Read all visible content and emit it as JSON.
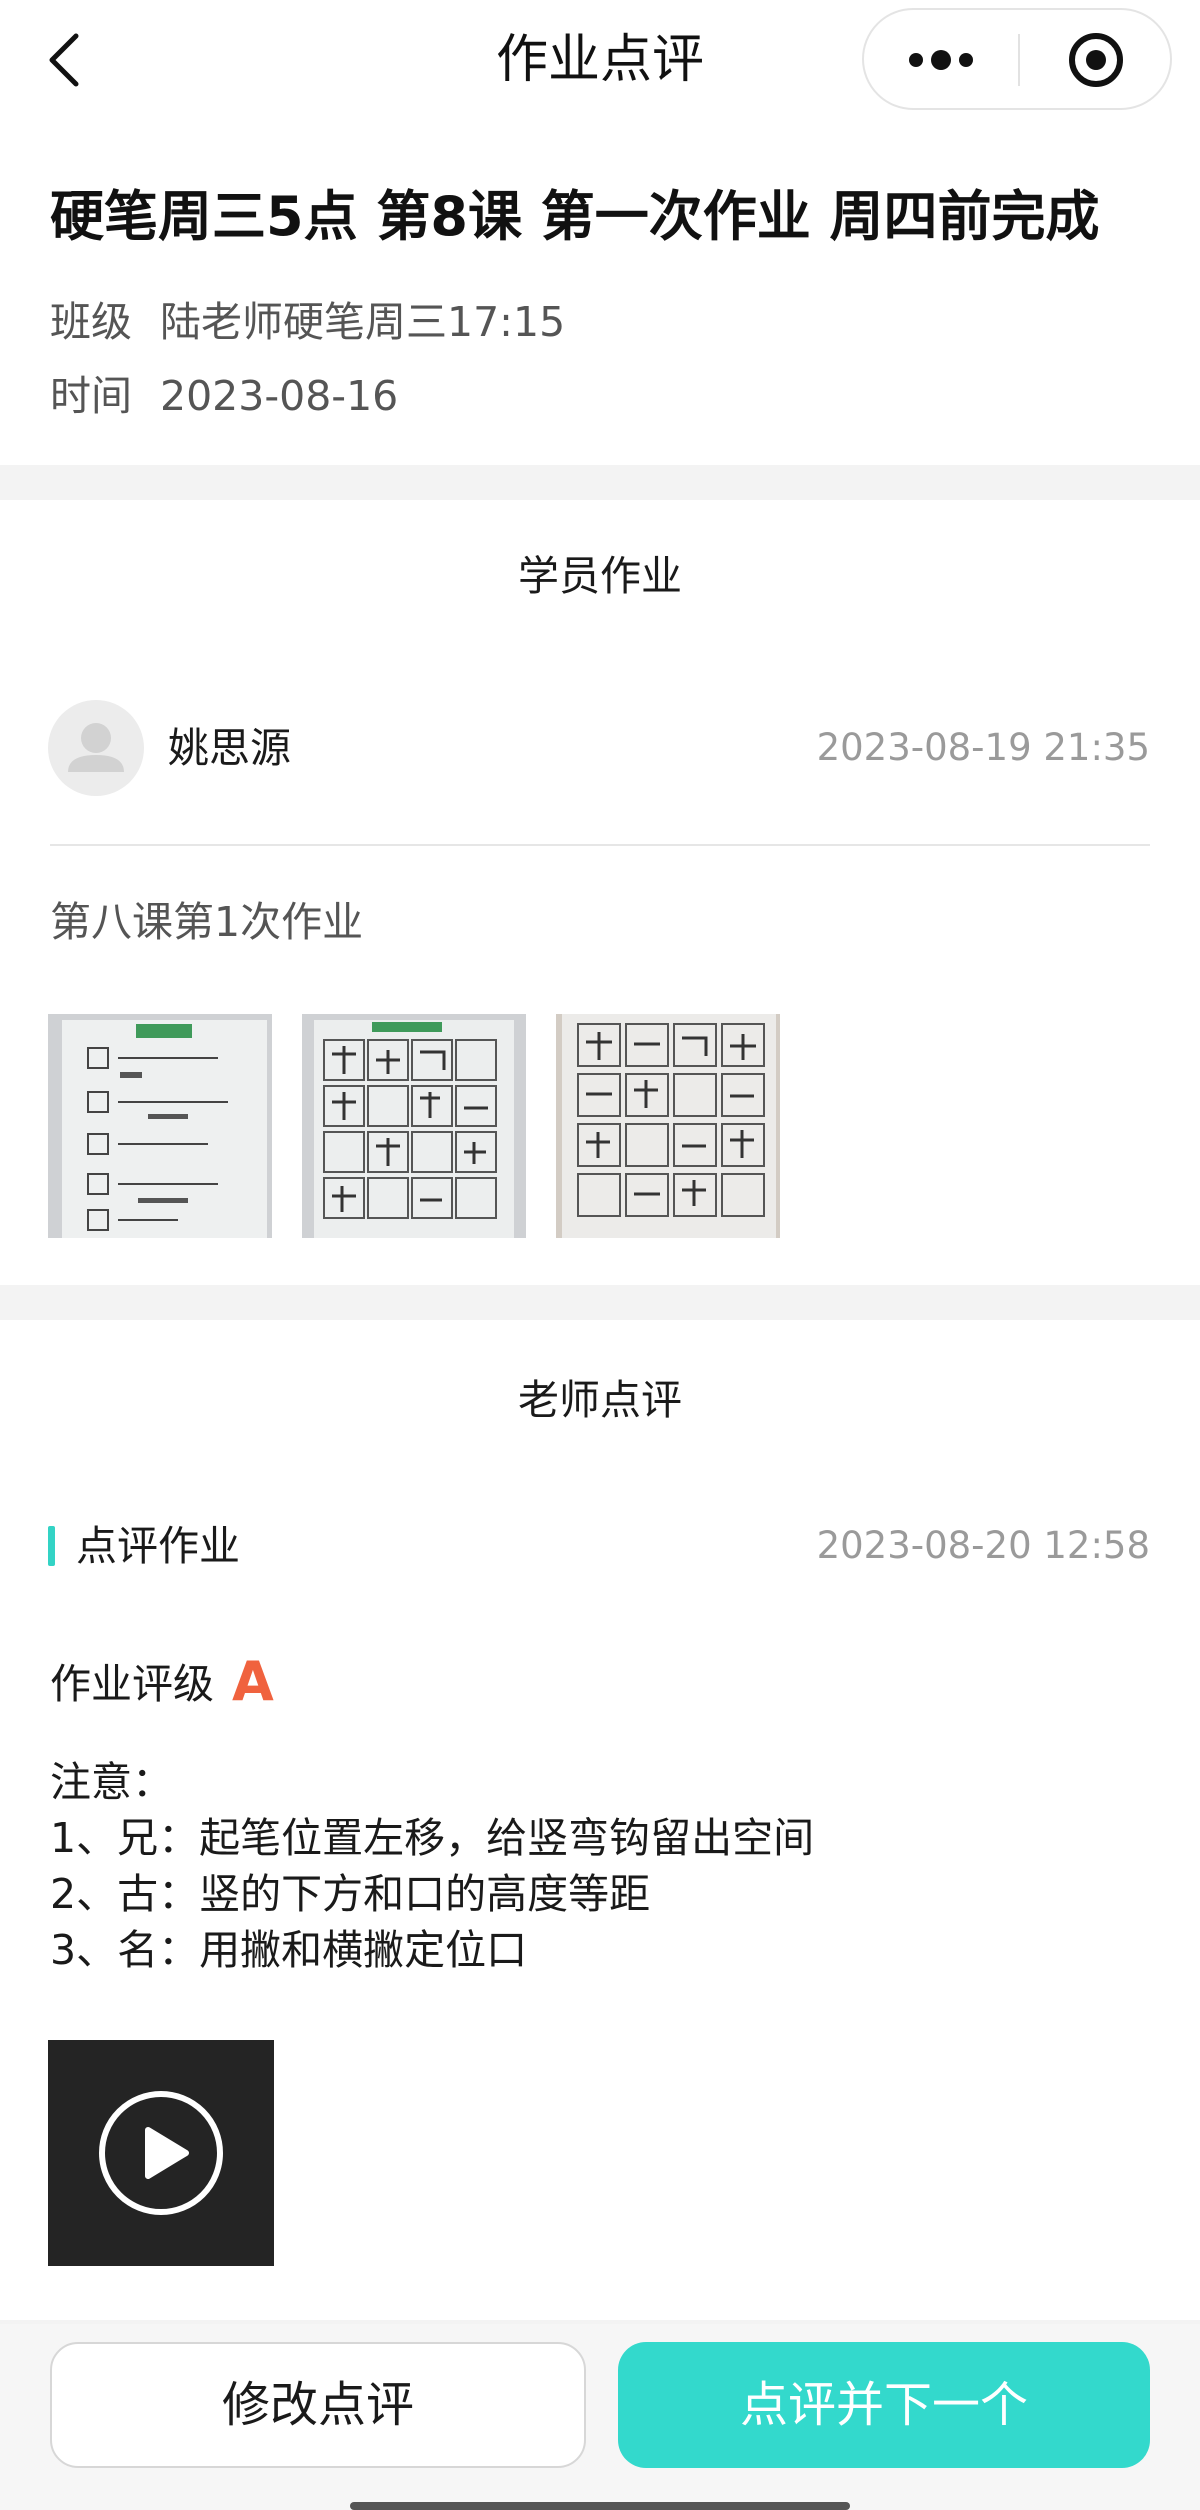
{
  "nav": {
    "title": "作业点评",
    "back_icon": "chevron-left-icon",
    "more_icon": "more-dots-icon",
    "close_icon": "target-circle-icon"
  },
  "homework": {
    "title": "硬笔周三5点 第8课 第一次作业 周四前完成",
    "class_label": "班级",
    "class_value": "陆老师硬笔周三17:15",
    "time_label": "时间",
    "time_value": "2023-08-16"
  },
  "student_section": {
    "title": "学员作业",
    "student_name": "姚思源",
    "submit_time": "2023-08-19 21:35",
    "text": "第八课第1次作业",
    "images": [
      "homework-photo-1",
      "homework-photo-2",
      "homework-photo-3"
    ]
  },
  "teacher_section": {
    "title": "老师点评",
    "review_label": "点评作业",
    "review_time": "2023-08-20 12:58",
    "grade_label": "作业评级",
    "grade_value": "A",
    "comment_lines": [
      "注意：",
      "1、兄：起笔位置左移，给竖弯钩留出空间",
      "2、古：竖的下方和口的高度等距",
      "3、名：用撇和横撇定位口"
    ],
    "video_icon": "play-icon"
  },
  "actions": {
    "edit_label": "修改点评",
    "next_label": "点评并下一个"
  },
  "colors": {
    "accent": "#33d9cc",
    "grade": "#f0623e",
    "muted": "#9a9a9a"
  }
}
